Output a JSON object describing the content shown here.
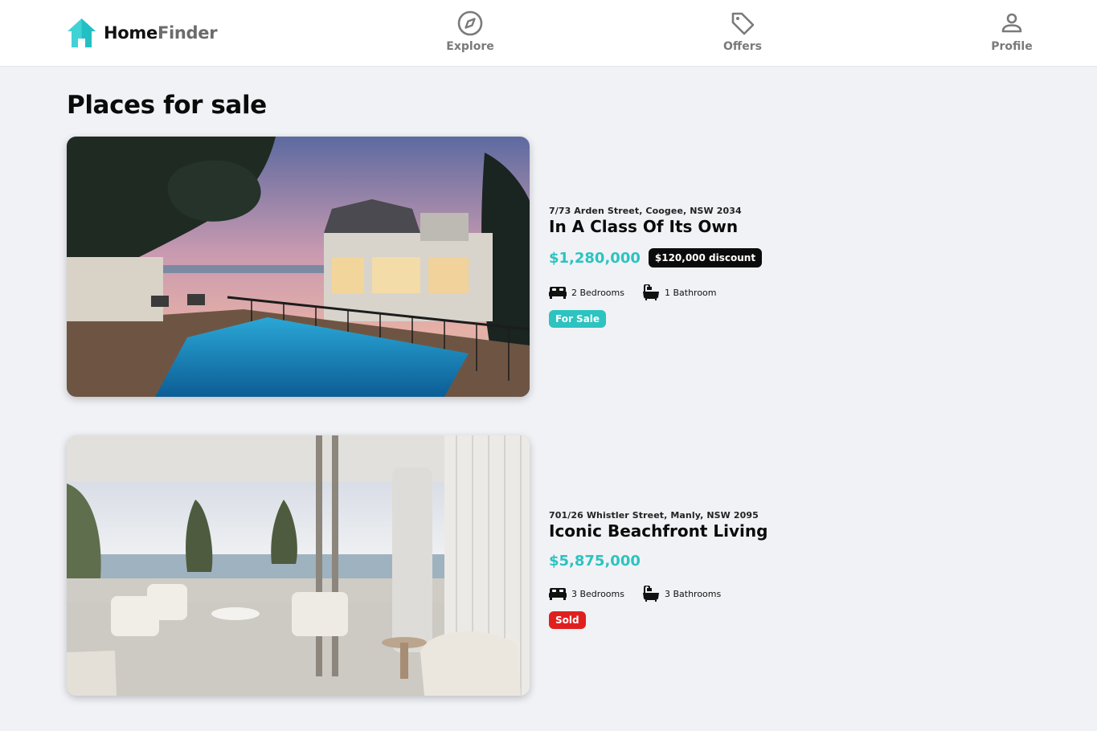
{
  "brand": {
    "name_part1": "Home",
    "name_part2": "Finder",
    "logo_color": "#3fd3d6",
    "logo_icon": "house-icon"
  },
  "nav": {
    "items": [
      {
        "label": "Explore",
        "icon": "compass-icon"
      },
      {
        "label": "Offers",
        "icon": "tag-icon"
      },
      {
        "label": "Profile",
        "icon": "user-icon"
      }
    ]
  },
  "page": {
    "title": "Places for sale"
  },
  "listings": [
    {
      "address": "7/73 Arden Street, Coogee, NSW 2034",
      "title": "In A Class Of Its Own",
      "price": "$1,280,000",
      "discount": "$120,000 discount",
      "bedrooms": "2 Bedrooms",
      "bathrooms": "1 Bathroom",
      "status": "For Sale",
      "status_color": "#2cc3c0",
      "photo": "house with pool at dusk"
    },
    {
      "address": "701/26 Whistler Street, Manly, NSW 2095",
      "title": "Iconic Beachfront Living",
      "price": "$5,875,000",
      "bedrooms": "3 Bedrooms",
      "bathrooms": "3 Bathrooms",
      "status": "Sold",
      "status_color": "#e0201f",
      "photo": "beachfront apartment balcony"
    }
  ],
  "colors": {
    "accent": "#2cc3c0",
    "sold": "#e0201f",
    "background": "#f1f2f6"
  }
}
